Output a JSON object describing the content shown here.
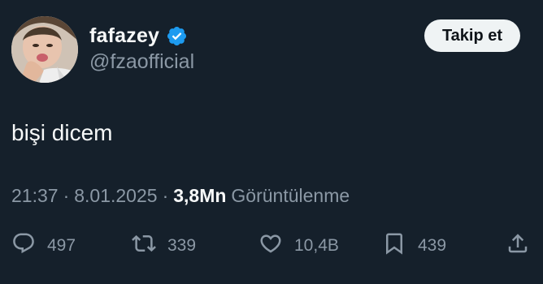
{
  "user": {
    "display_name": "fafazey",
    "handle": "@fzaofficial",
    "verified": true
  },
  "follow_button": {
    "label": "Takip et"
  },
  "tweet": {
    "text": "bişi dicem",
    "time": "21:37",
    "date": "8.01.2025",
    "separator": "·",
    "views_count": "3,8Mn",
    "views_label": "Görüntülenme"
  },
  "actions": {
    "replies": "497",
    "retweets": "339",
    "likes": "10,4B",
    "bookmarks": "439"
  },
  "colors": {
    "background": "#15202b",
    "text_primary": "#f7f9f9",
    "text_secondary": "#8b98a5",
    "verified_blue": "#1d9bf0",
    "button_bg": "#eff3f4"
  },
  "icons": {
    "verified": "verified-badge-icon",
    "reply": "reply-icon",
    "retweet": "retweet-icon",
    "like": "heart-icon",
    "bookmark": "bookmark-icon",
    "share": "share-icon"
  }
}
